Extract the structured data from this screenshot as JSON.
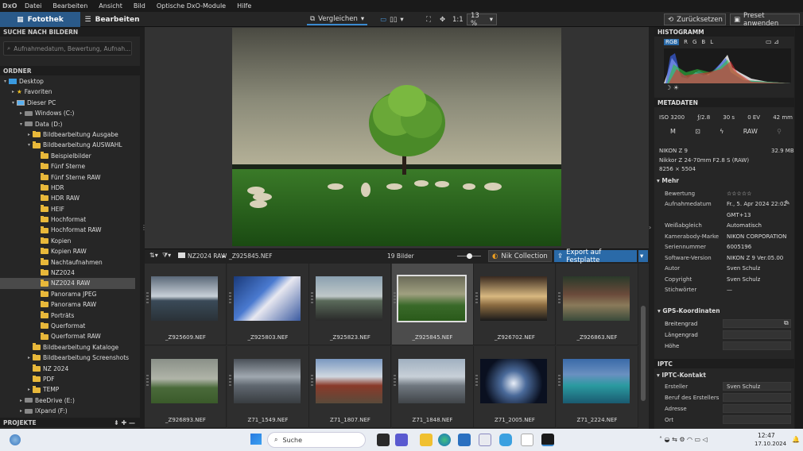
{
  "menu": {
    "logo": "DxO",
    "items": [
      "Datei",
      "Bearbeiten",
      "Ansicht",
      "Bild",
      "Optische DxO-Module",
      "Hilfe"
    ]
  },
  "toolbar": {
    "tab_library": "Fotothek",
    "tab_edit": "Bearbeiten",
    "compare": "Vergleichen",
    "one_to_one": "1:1",
    "zoom": "13 %",
    "reset": "Zurücksetzen",
    "preset": "Preset anwenden"
  },
  "left": {
    "search_title": "SUCHE NACH BILDERN",
    "search_placeholder": "Aufnahmedatum, Bewertung, Aufnah...",
    "folders_title": "ORDNER",
    "projects_title": "PROJEKTE",
    "tree": [
      {
        "label": "Desktop",
        "indent": 0,
        "arrow": "▾",
        "icon": "desktop"
      },
      {
        "label": "Favoriten",
        "indent": 1,
        "arrow": "▸",
        "icon": "star"
      },
      {
        "label": "Dieser PC",
        "indent": 1,
        "arrow": "▾",
        "icon": "pc"
      },
      {
        "label": "Windows (C:)",
        "indent": 2,
        "arrow": "▸",
        "icon": "drive"
      },
      {
        "label": "Data (D:)",
        "indent": 2,
        "arrow": "▾",
        "icon": "drive"
      },
      {
        "label": "Bildbearbeitung Ausgabe",
        "indent": 3,
        "arrow": "▸",
        "icon": "folder"
      },
      {
        "label": "Bildbearbeitung AUSWAHL",
        "indent": 3,
        "arrow": "▾",
        "icon": "folder"
      },
      {
        "label": "Beispielbilder",
        "indent": 4,
        "arrow": "",
        "icon": "folder"
      },
      {
        "label": "Fünf Sterne",
        "indent": 4,
        "arrow": "",
        "icon": "folder"
      },
      {
        "label": "Fünf Sterne RAW",
        "indent": 4,
        "arrow": "",
        "icon": "folder"
      },
      {
        "label": "HDR",
        "indent": 4,
        "arrow": "",
        "icon": "folder"
      },
      {
        "label": "HDR RAW",
        "indent": 4,
        "arrow": "",
        "icon": "folder"
      },
      {
        "label": "HEIF",
        "indent": 4,
        "arrow": "",
        "icon": "folder"
      },
      {
        "label": "Hochformat",
        "indent": 4,
        "arrow": "",
        "icon": "folder"
      },
      {
        "label": "Hochformat RAW",
        "indent": 4,
        "arrow": "",
        "icon": "folder"
      },
      {
        "label": "Kopien",
        "indent": 4,
        "arrow": "",
        "icon": "folder"
      },
      {
        "label": "Kopien RAW",
        "indent": 4,
        "arrow": "",
        "icon": "folder"
      },
      {
        "label": "Nachtaufnahmen",
        "indent": 4,
        "arrow": "",
        "icon": "folder"
      },
      {
        "label": "NZ2024",
        "indent": 4,
        "arrow": "",
        "icon": "folder"
      },
      {
        "label": "NZ2024 RAW",
        "indent": 4,
        "arrow": "",
        "icon": "folder",
        "selected": true
      },
      {
        "label": "Panorama JPEG",
        "indent": 4,
        "arrow": "",
        "icon": "folder"
      },
      {
        "label": "Panorama RAW",
        "indent": 4,
        "arrow": "",
        "icon": "folder"
      },
      {
        "label": "Porträts",
        "indent": 4,
        "arrow": "",
        "icon": "folder"
      },
      {
        "label": "Querformat",
        "indent": 4,
        "arrow": "",
        "icon": "folder"
      },
      {
        "label": "Querformat RAW",
        "indent": 4,
        "arrow": "",
        "icon": "folder"
      },
      {
        "label": "Bildbearbeitung Kataloge",
        "indent": 3,
        "arrow": "",
        "icon": "folder"
      },
      {
        "label": "Bildbearbeitung Screenshots",
        "indent": 3,
        "arrow": "▸",
        "icon": "folder"
      },
      {
        "label": "NZ 2024",
        "indent": 3,
        "arrow": "",
        "icon": "folder"
      },
      {
        "label": "PDF",
        "indent": 3,
        "arrow": "",
        "icon": "folder"
      },
      {
        "label": "TEMP",
        "indent": 3,
        "arrow": "▸",
        "icon": "folder"
      },
      {
        "label": "BeeDrive (E:)",
        "indent": 2,
        "arrow": "▸",
        "icon": "drive"
      },
      {
        "label": "IXpand (F:)",
        "indent": 2,
        "arrow": "▸",
        "icon": "drive"
      }
    ]
  },
  "film": {
    "path_folder": "NZ2024 RAW",
    "path_file": "_Z925845.NEF",
    "count": "19 Bilder",
    "nik": "Nik Collection",
    "export": "Export auf Festplatte",
    "thumbs": [
      {
        "name": "_Z925609.NEF",
        "bg": "linear-gradient(#5a6878,#c8d0d8 45%,#3a4a58 55%,#2a3238)"
      },
      {
        "name": "_Z925803.NEF",
        "bg": "linear-gradient(135deg,#1a3a7a,#4a7ad0 40%,#e8e8f0 55%,#3a5aa0)"
      },
      {
        "name": "_Z925823.NEF",
        "bg": "linear-gradient(#8aa0b0,#c0c8c8 45%,#5a6a5a 55%,#2a2a2a)"
      },
      {
        "name": "_Z925845.NEF",
        "bg": "linear-gradient(#6a6a58,#a0a080 40%,#3a6a2a 65%,#2a5a1a)",
        "selected": true
      },
      {
        "name": "_Z926702.NEF",
        "bg": "linear-gradient(#3a2a20,#d8b880 45%,#8a6a40 65%,#1a1a1a)"
      },
      {
        "name": "_Z926863.NEF",
        "bg": "linear-gradient(#2a3a2a,#6a4a3a 40%,#8a7a5a 65%,#3a4a3a)"
      },
      {
        "name": "_Z926893.NEF",
        "bg": "linear-gradient(#8a9088,#b0b4a8 45%,#4a6a3a 65%,#3a5a2a)"
      },
      {
        "name": "Z71_1549.NEF",
        "bg": "linear-gradient(#4a5058,#a0a8b0 40%,#606870 60%,#383c40)"
      },
      {
        "name": "Z71_1807.NEF",
        "bg": "linear-gradient(#7a98c0,#d0d8e0 40%,#8a3a2a 60%,#5a4a3a)"
      },
      {
        "name": "Z71_1848.NEF",
        "bg": "linear-gradient(#a0b0c0,#c8d0d8 40%,#707880 60%,#404448)"
      },
      {
        "name": "Z71_2005.NEF",
        "bg": "radial-gradient(circle at 50% 55%,#e8eef8,#4a6a9a 30%,#0a1020 70%)"
      },
      {
        "name": "Z71_2224.NEF",
        "bg": "linear-gradient(#3a6aa8,#6a90c0 35%,#2a9aa0 60%,#1a5a70)"
      }
    ]
  },
  "right": {
    "histogram_title": "HISTOGRAMM",
    "hist_tabs": [
      "RGB",
      "R",
      "G",
      "B",
      "L"
    ],
    "metadata_title": "METADATEN",
    "exif": [
      "ISO 3200",
      "ƒ/2.8",
      "30 s",
      "0 EV",
      "42 mm"
    ],
    "mode_m": "M",
    "mode_raw": "RAW",
    "camera": "NIKON Z 9",
    "size": "32.9 MB",
    "lens": "Nikkor Z 24-70mm F2.8 S (RAW)",
    "dims": "8256 × 5504",
    "more_title": "Mehr",
    "rows": [
      {
        "k": "Bewertung",
        "v": "☆☆☆☆☆"
      },
      {
        "k": "Aufnahmedatum",
        "v": "Fr., 5. Apr 2024 22:02"
      },
      {
        "k": "",
        "v": "GMT+13"
      },
      {
        "k": "Weißabgleich",
        "v": "Automatisch"
      },
      {
        "k": "Kamerabody-Marke",
        "v": "NIKON CORPORATION"
      },
      {
        "k": "Seriennummer",
        "v": "6005196"
      },
      {
        "k": "Software-Version",
        "v": "NIKON Z 9 Ver.05.00"
      },
      {
        "k": "Autor",
        "v": "Sven Schulz"
      },
      {
        "k": "Copyright",
        "v": "Sven Schulz"
      },
      {
        "k": "Stichwörter",
        "v": "—"
      }
    ],
    "gps_title": "GPS-Koordinaten",
    "gps": [
      "Breitengrad",
      "Längengrad",
      "Höhe"
    ],
    "iptc_title": "IPTC",
    "iptc_contact": "IPTC-Kontakt",
    "iptc": [
      {
        "k": "Ersteller",
        "v": "Sven Schulz"
      },
      {
        "k": "Beruf des Erstellers",
        "v": ""
      },
      {
        "k": "Adresse",
        "v": ""
      },
      {
        "k": "Ort",
        "v": ""
      }
    ]
  },
  "taskbar": {
    "search": "Suche",
    "time": "12:47",
    "date": "17.10.2024"
  }
}
